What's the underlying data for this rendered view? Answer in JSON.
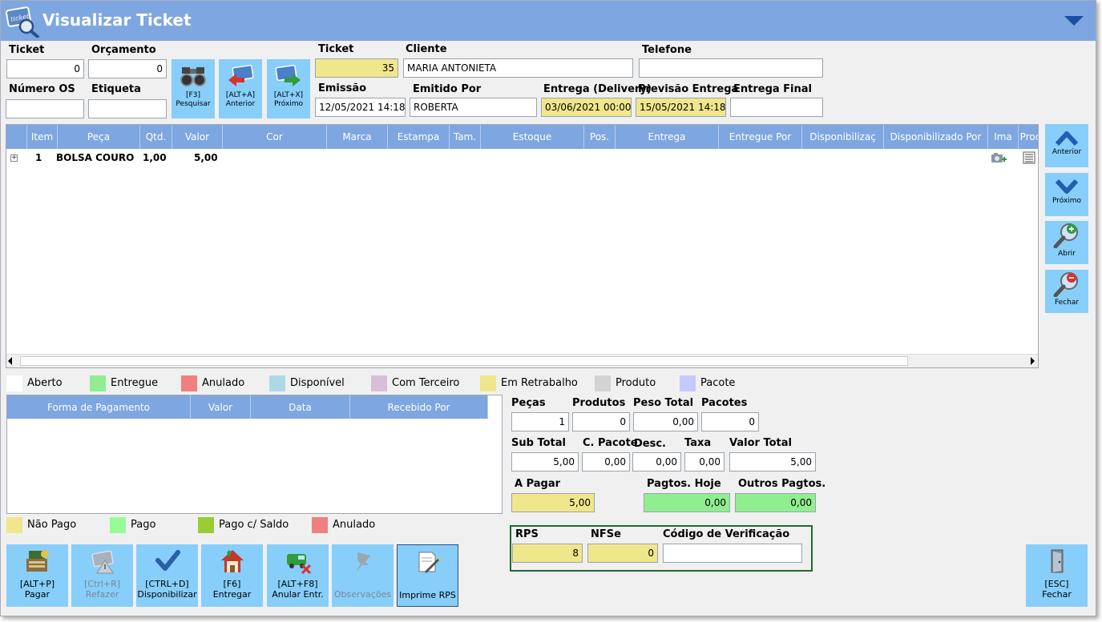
{
  "window": {
    "title": "Visualizar Ticket"
  },
  "header": {
    "ticket_label": "Ticket",
    "ticket_value": "0",
    "orcamento_label": "Orçamento",
    "orcamento_value": "0",
    "numero_os_label": "Número OS",
    "numero_os_value": "",
    "etiqueta_label": "Etiqueta",
    "etiqueta_value": "",
    "buttons": [
      {
        "key": "[F3]",
        "label": "Pesquisar"
      },
      {
        "key": "[ALT+A]",
        "label": "Anterior"
      },
      {
        "key": "[ALT+X]",
        "label": "Próximo"
      }
    ],
    "ticket2_label": "Ticket",
    "ticket2_value": "35",
    "cliente_label": "Cliente",
    "cliente_value": "MARIA ANTONIETA",
    "telefone_label": "Telefone",
    "telefone_value": "",
    "emissao_label": "Emissão",
    "emissao_value": "12/05/2021 14:18",
    "emitido_label": "Emitido Por",
    "emitido_value": "ROBERTA",
    "entrega_delivery_label": "Entrega (Delivery)",
    "entrega_delivery_value": "03/06/2021 00:00",
    "previsao_label": "Previsão Entrega",
    "previsao_value": "15/05/2021 14:18",
    "entrega_final_label": "Entrega Final",
    "entrega_final_value": ""
  },
  "items_grid": {
    "columns": [
      "Item",
      "Peça",
      "Qtd.",
      "Valor",
      "Cor",
      "Marca",
      "Estampa",
      "Tam.",
      "Estoque",
      "Pos.",
      "Entrega",
      "Entregue Por",
      "Disponibilizaç",
      "Disponibilizado Por",
      "Ima",
      "Proc"
    ],
    "rows": [
      {
        "item": "1",
        "peca": "BOLSA COURO",
        "qtd": "1,00",
        "valor": "5,00"
      }
    ],
    "expander": "+"
  },
  "side_buttons": [
    {
      "label": "Anterior",
      "icon": "chevron-up-icon"
    },
    {
      "label": "Próximo",
      "icon": "chevron-down-icon"
    },
    {
      "label": "Abrir",
      "icon": "zoom-in-icon"
    },
    {
      "label": "Fechar",
      "icon": "zoom-out-icon"
    }
  ],
  "status_legend": [
    {
      "label": "Aberto",
      "color": "#ffffff"
    },
    {
      "label": "Entregue",
      "color": "#90ee90"
    },
    {
      "label": "Anulado",
      "color": "#f08080"
    },
    {
      "label": "Disponível",
      "color": "#add8e6"
    },
    {
      "label": "Com Terceiro",
      "color": "#d8bfd8"
    },
    {
      "label": "Em Retrabalho",
      "color": "#f0e68c"
    },
    {
      "label": "Produto",
      "color": "#d3d3d3"
    },
    {
      "label": "Pacote",
      "color": "#c8c8ff"
    }
  ],
  "payments_grid": {
    "columns": [
      "Forma de Pagamento",
      "Valor",
      "Data",
      "Recebido Por"
    ]
  },
  "payment_legend": [
    {
      "label": "Não Pago",
      "color": "#f0e68c"
    },
    {
      "label": "Pago",
      "color": "#98fb98"
    },
    {
      "label": "Pago c/ Saldo",
      "color": "#9acd32"
    },
    {
      "label": "Anulado",
      "color": "#f08080"
    }
  ],
  "totals": {
    "pecas_label": "Peças",
    "pecas_value": "1",
    "produtos_label": "Produtos",
    "produtos_value": "0",
    "peso_label": "Peso Total",
    "peso_value": "0,00",
    "pacotes_label": "Pacotes",
    "pacotes_value": "0",
    "subtotal_label": "Sub Total",
    "subtotal_value": "5,00",
    "cpacote_label": "C. Pacote",
    "cpacote_value": "0,00",
    "desc_label": "Desc.",
    "desc_value": "0,00",
    "taxa_label": "Taxa",
    "taxa_value": "0,00",
    "valortotal_label": "Valor Total",
    "valortotal_value": "5,00",
    "apagar_label": "A Pagar",
    "apagar_value": "5,00",
    "pagtos_hoje_label": "Pagtos. Hoje",
    "pagtos_hoje_value": "0,00",
    "outros_label": "Outros Pagtos.",
    "outros_value": "0,00"
  },
  "rps": {
    "rps_label": "RPS",
    "rps_value": "8",
    "nfse_label": "NFSe",
    "nfse_value": "0",
    "codigo_label": "Código de Verificação",
    "codigo_value": ""
  },
  "bottom_buttons": [
    {
      "key": "[ALT+P]",
      "label": "Pagar"
    },
    {
      "key": "[Ctrl+R]",
      "label": "Refazer"
    },
    {
      "key": "[CTRL+D]",
      "label": "Disponibilizar"
    },
    {
      "key": "[F6]",
      "label": "Entregar"
    },
    {
      "key": "[ALT+F8]",
      "label": "Anular Entr."
    },
    {
      "key": "",
      "label": "Observações"
    },
    {
      "key": "",
      "label": "Imprime RPS"
    }
  ],
  "close_button": {
    "key": "[ESC]",
    "label": "Fechar"
  },
  "colors": {
    "titlebar": "#7ea6e0",
    "button": "#87cefa",
    "highlight_yellow": "#f0e68c",
    "highlight_green": "#90ee90",
    "rps_border": "#1e6b2e"
  }
}
